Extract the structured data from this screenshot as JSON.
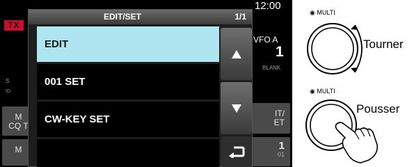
{
  "background": {
    "tx_badge": "TX",
    "s_label": "S",
    "id_label": "ID",
    "left_btn1": [
      "M",
      "CQ T"
    ],
    "left_btn2": "M",
    "right_btn1": [
      "IT/",
      "ET"
    ],
    "right_btn2": [
      "1",
      "01"
    ],
    "clock": "12:00",
    "vfo_label": "VFO A",
    "vfo_number": "1",
    "blank_label": "BLANK"
  },
  "dialog": {
    "title": "EDIT/SET",
    "page": "1/1",
    "items": [
      {
        "label": "EDIT",
        "selected": true
      },
      {
        "label": "001 SET",
        "selected": false
      },
      {
        "label": "CW-KEY SET",
        "selected": false
      },
      {
        "label": "",
        "selected": false
      }
    ],
    "buttons": {
      "up": "up-arrow-icon",
      "down": "down-arrow-icon",
      "back": "return-arrow-icon"
    }
  },
  "annotations": {
    "multi_label_1": "MULTI",
    "multi_label_2": "MULTI",
    "turn_text": "Tourner",
    "push_text": "Pousser"
  },
  "colors": {
    "selected_bg": "#aee5f0",
    "tx_red": "#c8102e",
    "dialog_bg": "#1e1e1e"
  }
}
